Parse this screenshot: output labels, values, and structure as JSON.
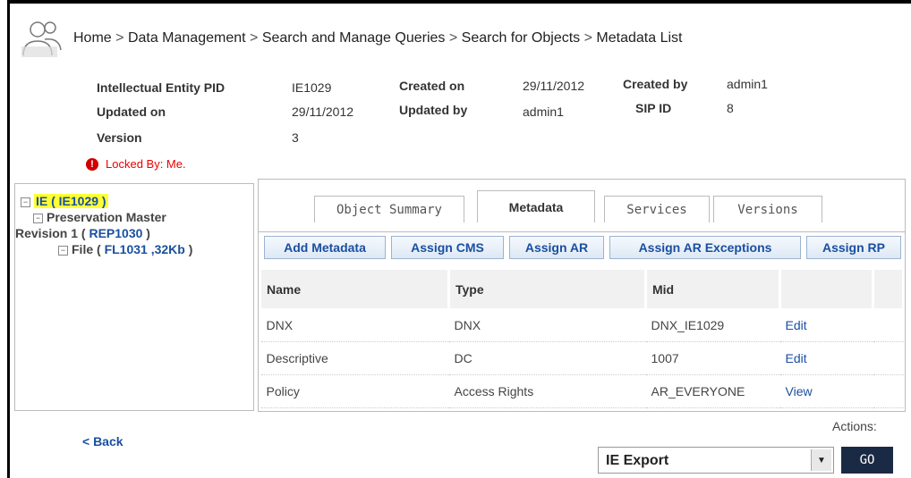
{
  "breadcrumb": {
    "items": [
      "Home",
      "Data Management",
      "Search and Manage Queries",
      "Search for Objects",
      "Metadata List"
    ],
    "separator": ">"
  },
  "entity": {
    "pid_label": "Intellectual Entity PID",
    "pid_value": "IE1029",
    "created_on_label": "Created on",
    "created_on_value": "29/11/2012",
    "created_by_label": "Created by",
    "created_by_value": "admin1",
    "updated_on_label": "Updated on",
    "updated_on_value": "29/11/2012",
    "updated_by_label": "Updated by",
    "updated_by_value": "admin1",
    "sip_label": "SIP ID",
    "sip_value": "8",
    "version_label": "Version",
    "version_value": "3",
    "locked_text": "Locked By: Me."
  },
  "tree": {
    "ie_label": "IE ( IE1029 )",
    "rep_prefix": "Preservation Master",
    "rep_line2": "Revision 1 ( ",
    "rep_id": "REP1030",
    "rep_close": " )",
    "file_prefix": "File ( ",
    "file_id": "FL1031 ,32Kb",
    "file_close": " )"
  },
  "tabs": [
    "Object Summary",
    "Metadata",
    "Services",
    "Versions"
  ],
  "active_tab": "Metadata",
  "actions": [
    "Add Metadata",
    "Assign CMS",
    "Assign AR",
    "Assign AR Exceptions",
    "Assign RP"
  ],
  "table": {
    "headers": [
      "Name",
      "Type",
      "Mid",
      "",
      ""
    ],
    "rows": [
      [
        "DNX",
        "DNX",
        "DNX_IE1029",
        "Edit"
      ],
      [
        "Descriptive",
        "DC",
        "1007",
        "Edit"
      ],
      [
        "Policy",
        "Access Rights",
        "AR_EVERYONE",
        "View"
      ]
    ]
  },
  "footer": {
    "back_label": "< Back",
    "actions_label": "Actions:",
    "select_value": "IE Export",
    "go_label": "GO"
  },
  "colors": {
    "link": "#1a4fa0",
    "highlight": "#ffff33",
    "locked": "#e00000",
    "go_button": "#1b2a44"
  }
}
